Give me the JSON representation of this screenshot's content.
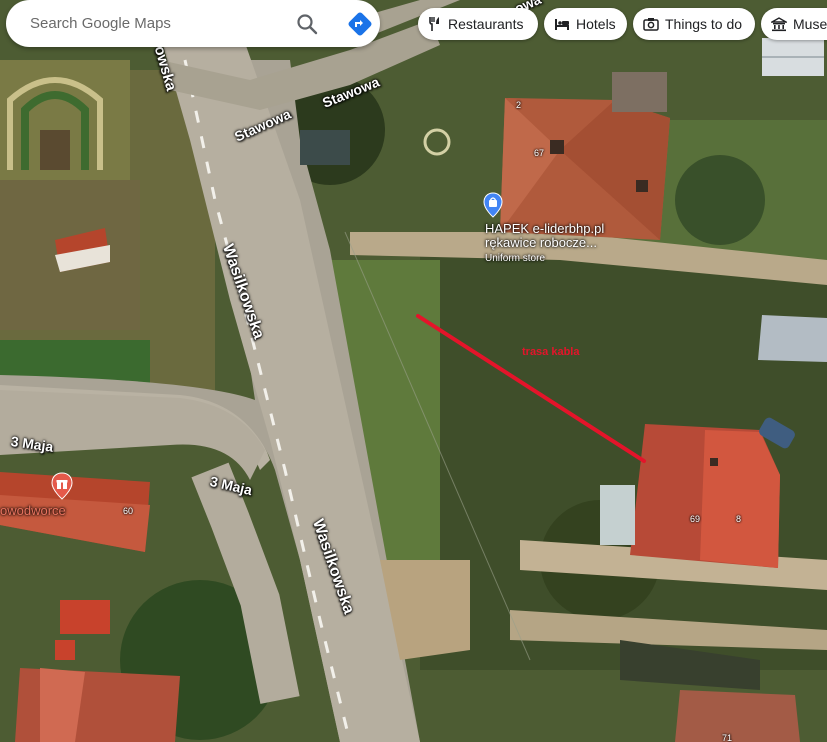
{
  "search": {
    "placeholder": "Search Google Maps"
  },
  "chips": [
    {
      "label": "Restaurants",
      "icon": "fork-knife-icon"
    },
    {
      "label": "Hotels",
      "icon": "bed-icon"
    },
    {
      "label": "Things to do",
      "icon": "camera-icon"
    },
    {
      "label": "Muse",
      "icon": "museum-icon"
    }
  ],
  "streets": {
    "stawowa_1": "Stawowa",
    "stawowa_2": "Stawowa",
    "stawowa_3": "owa",
    "wasilkowska_top": "owska",
    "wasilkowska_mid": "Wasilkowska",
    "wasilkowska_bottom": "Wasilkowska",
    "maja_left": "3 Maja",
    "maja_right": "3 Maja"
  },
  "poi": {
    "hapek_line1": "HAPEK e-liderbhp.pl",
    "hapek_line2": "rękawice robocze...",
    "hapek_category": "Uniform store",
    "owodworce": "owodworce"
  },
  "house_numbers": {
    "n2": "2",
    "n67": "67",
    "n60": "60",
    "n69": "69",
    "n8": "8",
    "n71": "71"
  },
  "annotation": {
    "label": "trasa kabla",
    "color": "#e4142a"
  }
}
